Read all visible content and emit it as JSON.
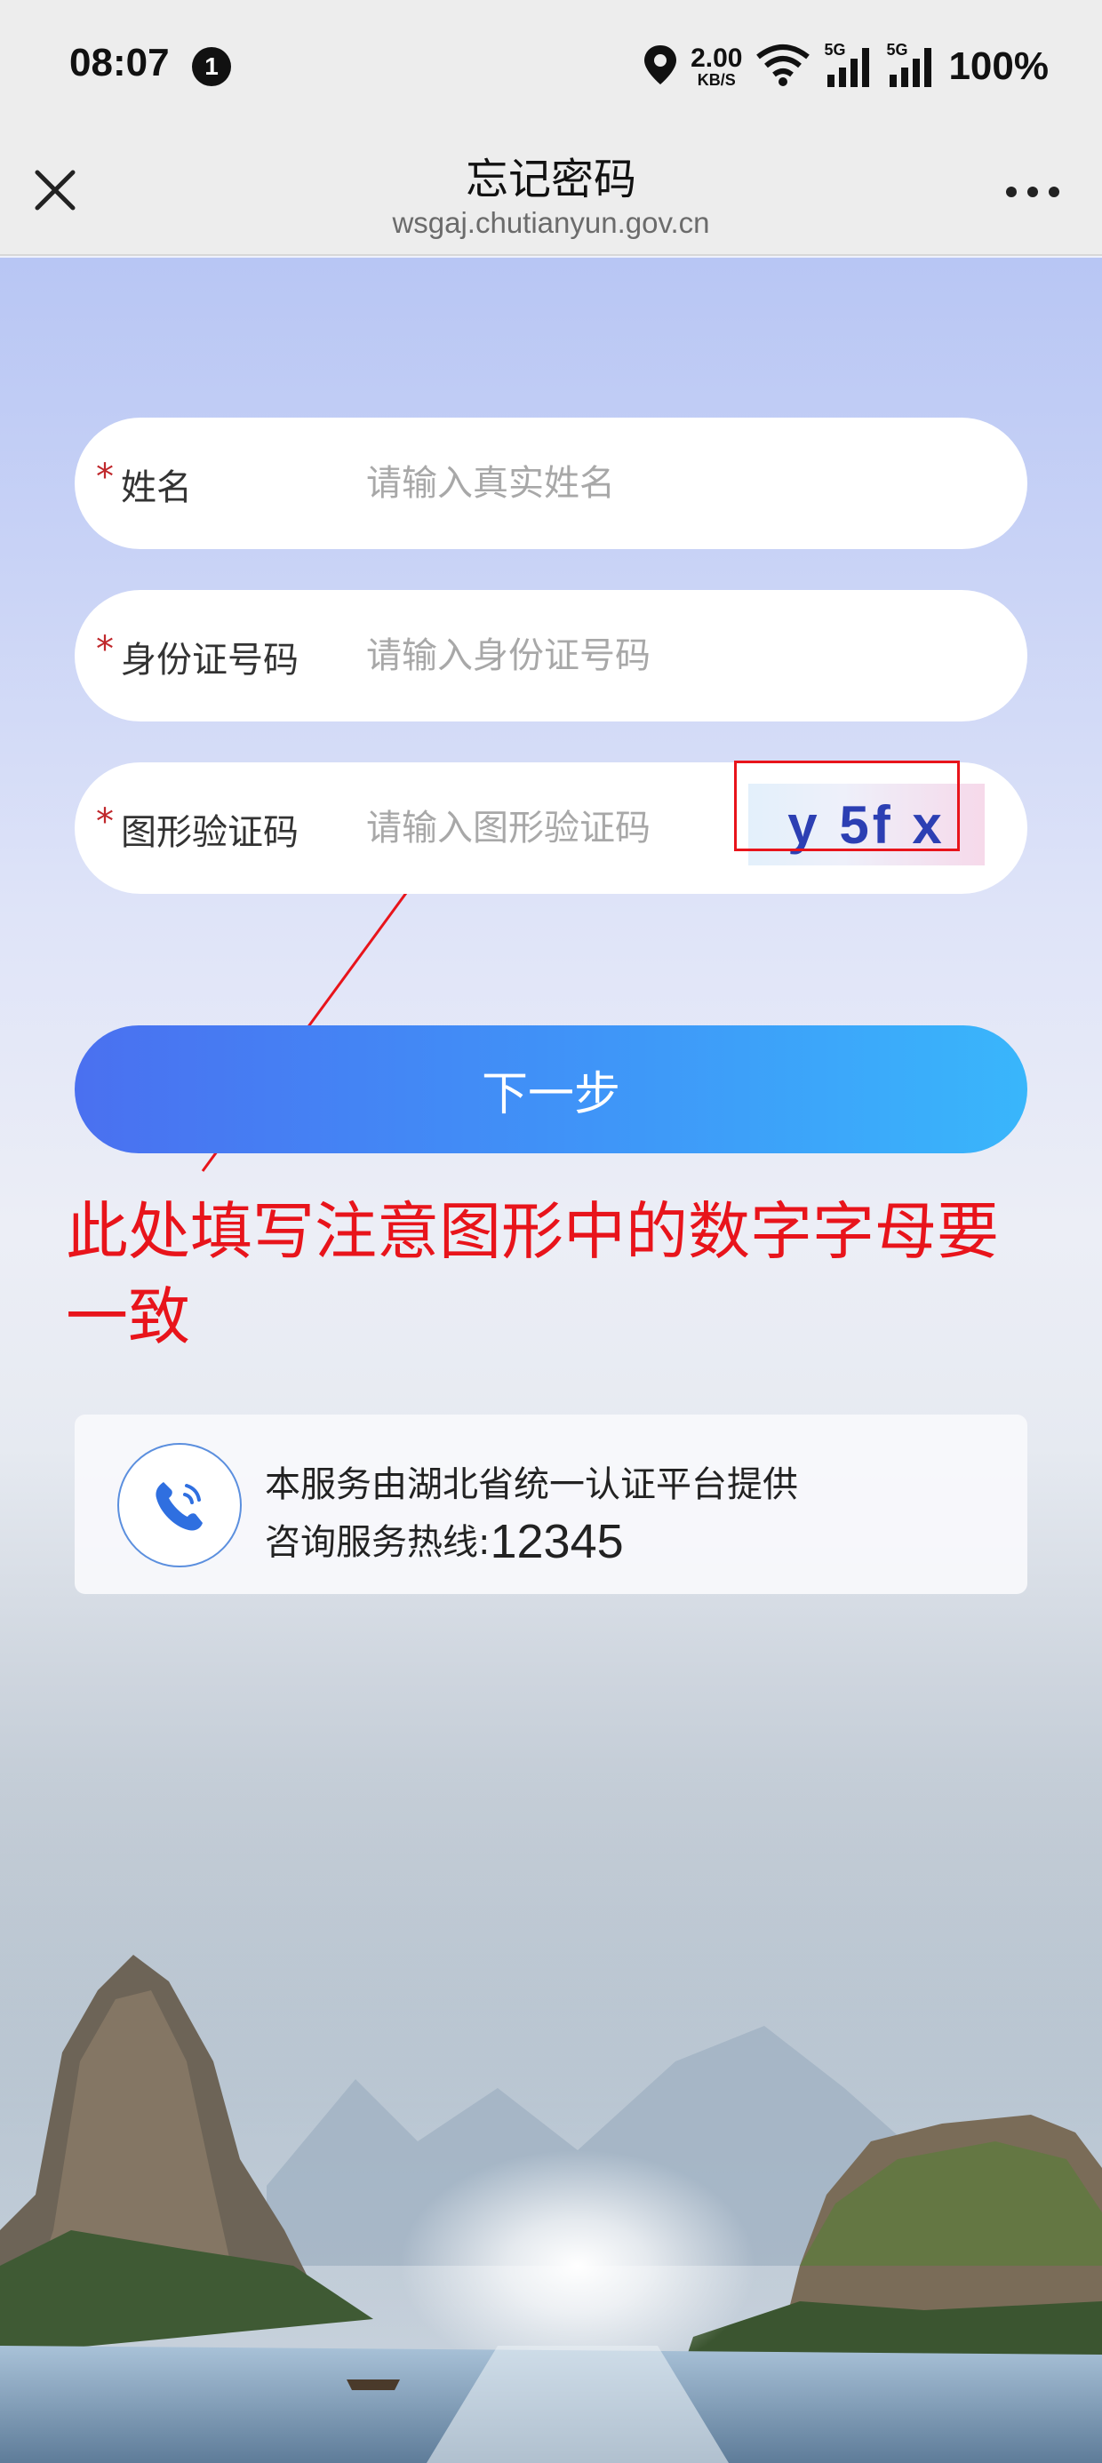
{
  "status_bar": {
    "time": "08:07",
    "notification_count": "1",
    "net_speed_value": "2.00",
    "net_speed_unit": "KB/S",
    "signal1_tag": "5G",
    "signal2_tag": "5G",
    "battery": "100%"
  },
  "nav": {
    "title": "忘记密码",
    "url": "wsgaj.chutianyun.gov.cn"
  },
  "form": {
    "required_mark": "*",
    "name": {
      "label": "姓名",
      "placeholder": "请输入真实姓名"
    },
    "id_number": {
      "label": "身份证号码",
      "placeholder": "请输入身份证号码"
    },
    "captcha": {
      "label": "图形验证码",
      "placeholder": "请输入图形验证码",
      "image_text": "y 5f x"
    },
    "next_label": "下一步"
  },
  "annotation": {
    "text": "此处填写注意图形中的数字字母要一致",
    "color": "#e8141b"
  },
  "info": {
    "line1": "本服务由湖北省统一认证平台提供",
    "hotline_label": "咨询服务热线:",
    "hotline_number": "12345"
  },
  "colors": {
    "accent": "#3f8cf6",
    "required": "#c0282c",
    "captcha_text": "#2c3fb3"
  },
  "icons": {
    "close": "close-icon",
    "more": "more-icon",
    "location": "location-icon",
    "wifi": "wifi-icon",
    "signal": "signal-icon",
    "phone": "phone-icon"
  }
}
